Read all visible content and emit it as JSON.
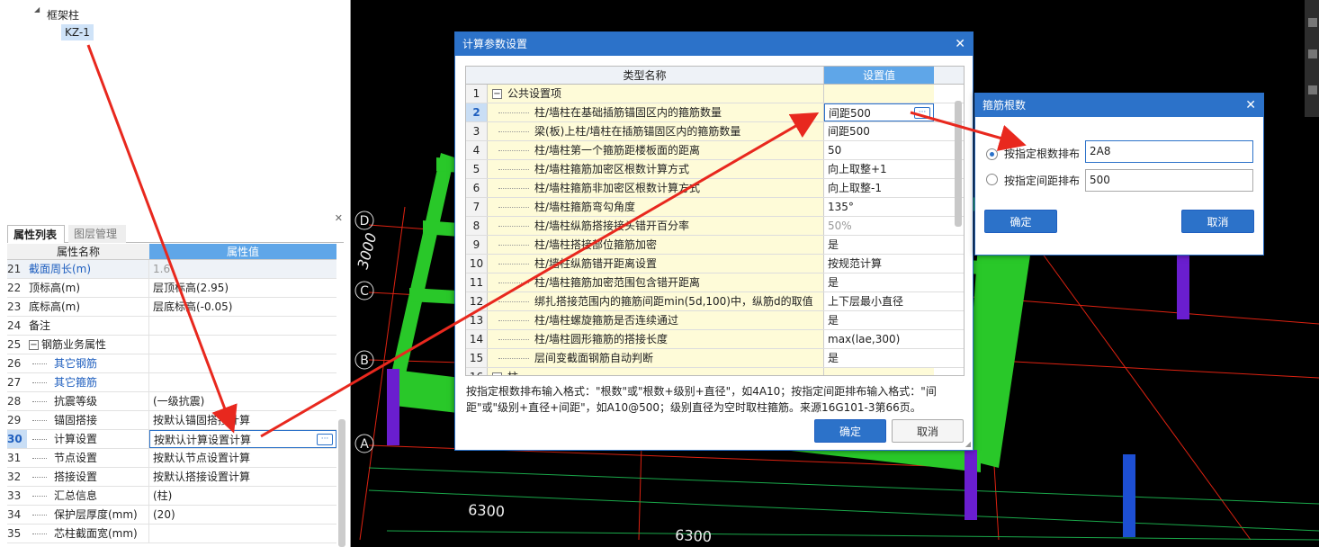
{
  "tree": {
    "node_parent": "框架柱",
    "node_child": "KZ-1"
  },
  "props": {
    "tabs": [
      "属性列表",
      "图层管理"
    ],
    "header": {
      "name": "属性名称",
      "value": "属性值"
    },
    "rows": [
      {
        "num": "21",
        "name": "截面周长(m)",
        "value": "1.6"
      },
      {
        "num": "22",
        "name": "顶标高(m)",
        "value": "层顶标高(2.95)"
      },
      {
        "num": "23",
        "name": "底标高(m)",
        "value": "层底标高(-0.05)"
      },
      {
        "num": "24",
        "name": "备注",
        "value": ""
      },
      {
        "num": "25",
        "name": "钢筋业务属性",
        "value": ""
      },
      {
        "num": "26",
        "name": "其它钢筋",
        "value": ""
      },
      {
        "num": "27",
        "name": "其它箍筋",
        "value": ""
      },
      {
        "num": "28",
        "name": "抗震等级",
        "value": "(一级抗震)"
      },
      {
        "num": "29",
        "name": "锚固搭接",
        "value": "按默认锚固搭接计算"
      },
      {
        "num": "30",
        "name": "计算设置",
        "value": "按默认计算设置计算"
      },
      {
        "num": "31",
        "name": "节点设置",
        "value": "按默认节点设置计算"
      },
      {
        "num": "32",
        "name": "搭接设置",
        "value": "按默认搭接设置计算"
      },
      {
        "num": "33",
        "name": "汇总信息",
        "value": "(柱)"
      },
      {
        "num": "34",
        "name": "保护层厚度(mm)",
        "value": "(20)"
      },
      {
        "num": "35",
        "name": "芯柱截面宽(mm)",
        "value": ""
      }
    ]
  },
  "scene": {
    "axes": [
      "D",
      "C",
      "B",
      "A"
    ],
    "dims": [
      "3000",
      "6300",
      "6300"
    ]
  },
  "calc_dialog": {
    "title": "计算参数设置",
    "header": {
      "name": "类型名称",
      "value": "设置值"
    },
    "rows": [
      {
        "num": "1",
        "name": "公共设置项",
        "value": ""
      },
      {
        "num": "2",
        "name": "柱/墙柱在基础插筋锚固区内的箍筋数量",
        "value": "间距500"
      },
      {
        "num": "3",
        "name": "梁(板)上柱/墙柱在插筋锚固区内的箍筋数量",
        "value": "间距500"
      },
      {
        "num": "4",
        "name": "柱/墙柱第一个箍筋距楼板面的距离",
        "value": "50"
      },
      {
        "num": "5",
        "name": "柱/墙柱箍筋加密区根数计算方式",
        "value": "向上取整+1"
      },
      {
        "num": "6",
        "name": "柱/墙柱箍筋非加密区根数计算方式",
        "value": "向上取整-1"
      },
      {
        "num": "7",
        "name": "柱/墙柱箍筋弯勾角度",
        "value": "135°"
      },
      {
        "num": "8",
        "name": "柱/墙柱纵筋搭接接头错开百分率",
        "value": "50%"
      },
      {
        "num": "9",
        "name": "柱/墙柱搭接部位箍筋加密",
        "value": "是"
      },
      {
        "num": "10",
        "name": "柱/墙柱纵筋错开距离设置",
        "value": "按规范计算"
      },
      {
        "num": "11",
        "name": "柱/墙柱箍筋加密范围包含错开距离",
        "value": "是"
      },
      {
        "num": "12",
        "name": "绑扎搭接范围内的箍筋间距min(5d,100)中，纵筋d的取值",
        "value": "上下层最小直径"
      },
      {
        "num": "13",
        "name": "柱/墙柱螺旋箍筋是否连续通过",
        "value": "是"
      },
      {
        "num": "14",
        "name": "柱/墙柱圆形箍筋的搭接长度",
        "value": "max(lae,300)"
      },
      {
        "num": "15",
        "name": "层间变截面钢筋自动判断",
        "value": "是"
      },
      {
        "num": "16",
        "name": "柱",
        "value": ""
      }
    ],
    "note": "按指定根数排布输入格式：\"根数\"或\"根数+级别+直径\"，如4A10；按指定间距排布输入格式：\"间距\"或\"级别+直径+间距\"，如A10@500；级别直径为空时取柱箍筋。来源16G101-3第66页。",
    "ok": "确定",
    "cancel": "取消"
  },
  "stirrup_dialog": {
    "title": "箍筋根数",
    "option1_label": "按指定根数排布",
    "option1_value": "2A8",
    "option2_label": "按指定间距排布",
    "option2_value": "500",
    "ok": "确定",
    "cancel": "取消"
  }
}
